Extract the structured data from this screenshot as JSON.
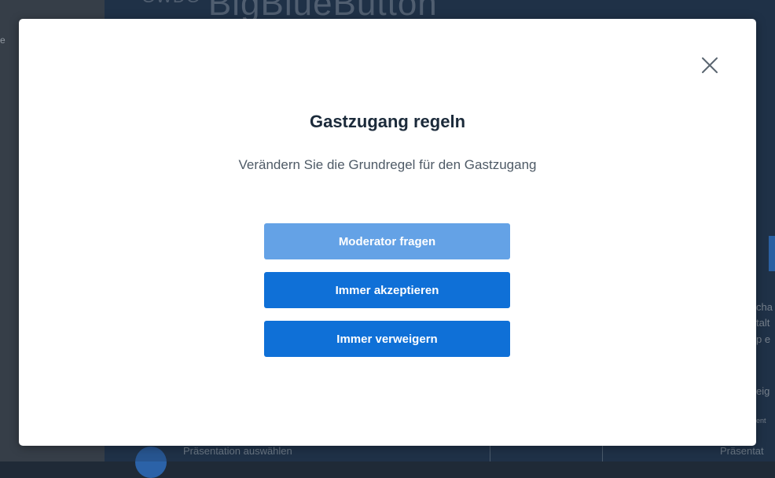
{
  "background": {
    "logo_org": "GWDG",
    "logo_product": "BigBlueButton",
    "left_panel_fragment": "e",
    "bottom_left_text": "Präsentation auswählen",
    "bottom_right_text": "Präsentat",
    "right_fragments": [
      "cha",
      "talt",
      "p e",
      "eig",
      "ent"
    ]
  },
  "dialog": {
    "title": "Gastzugang regeln",
    "subtitle": "Verändern Sie die Grundregel für den Gastzugang",
    "close_label": "×",
    "options": [
      {
        "label": "Moderator fragen",
        "state": "selected"
      },
      {
        "label": "Immer akzeptieren",
        "state": "normal"
      },
      {
        "label": "Immer verweigern",
        "state": "normal"
      }
    ]
  },
  "colors": {
    "primary": "#0f70d7",
    "primary_selected": "#64a2e6",
    "title": "#1b2a3a",
    "text": "#4e5a66"
  }
}
